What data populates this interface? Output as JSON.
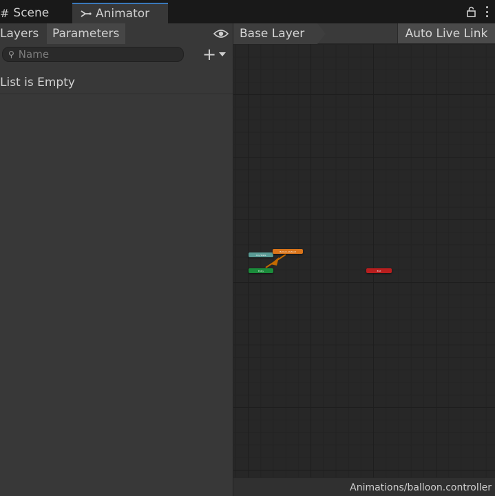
{
  "window": {
    "tabs": [
      {
        "label": "Scene",
        "icon": "grid-hash-icon"
      },
      {
        "label": "Animator",
        "icon": "animator-icon",
        "active": true
      }
    ],
    "icons": {
      "lock": "lock-icon",
      "menu": "kebab-menu-icon"
    }
  },
  "left_panel": {
    "subtabs": [
      {
        "label": "Layers"
      },
      {
        "label": "Parameters",
        "active": true
      }
    ],
    "visibility_icon": "eye-icon",
    "search": {
      "placeholder": "Name",
      "value": ""
    },
    "add_button": {
      "label": "+",
      "icon": "plus-icon"
    },
    "empty_text": "List is Empty"
  },
  "graph": {
    "breadcrumb": "Base Layer",
    "live_link_label": "Auto Live Link",
    "states": [
      {
        "name": "Any State",
        "color": "#5a9b95"
      },
      {
        "name": "Balloon_Default",
        "color": "#d9741a"
      },
      {
        "name": "Entry",
        "color": "#1b8c3b"
      },
      {
        "name": "Exit",
        "color": "#b81e1e"
      }
    ],
    "transition_color": "#c46a00"
  },
  "status_bar": {
    "path": "Animations/balloon.controller"
  }
}
